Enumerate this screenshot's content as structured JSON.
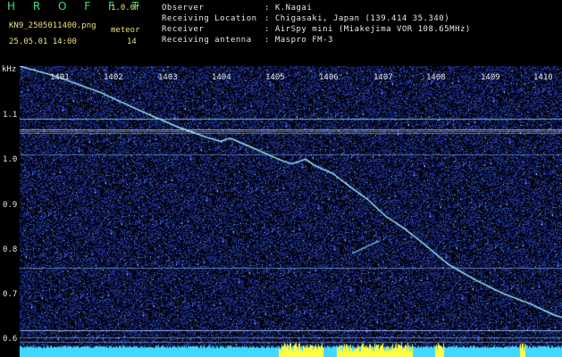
{
  "header": {
    "logo": "H R O F F T",
    "version": "1.0.0f",
    "filename": "KN9_2505011400.png",
    "datetime": "25.05.01 14:00",
    "meteor_label": "meteor",
    "meteor_count": "14"
  },
  "info": [
    {
      "label": "Observer",
      "value": ": K.Nagai"
    },
    {
      "label": "Receiving Location",
      "value": ": Chigasaki, Japan (139.414 35.340)"
    },
    {
      "label": "Receiver",
      "value": ": AirSpy mini (Miakejima VOR 108.65MHz)"
    },
    {
      "label": "Receiving antenna",
      "value": ": Maspro FM-3"
    }
  ],
  "axes": {
    "y_unit": "kHz",
    "x_ticks": [
      "1401",
      "1402",
      "1403",
      "1404",
      "1405",
      "1406",
      "1407",
      "1408",
      "1409",
      "1410"
    ],
    "y_ticks": [
      "1.1",
      "1.0",
      "0.9",
      "0.8",
      "0.7",
      "0.6"
    ]
  },
  "colors": {
    "background": "#000000",
    "noise": "#1b2fa0",
    "trace": "#9ef0ff",
    "band": "#7fd9ff",
    "bottom_strip": "#3fd8ff",
    "meteor_strip": "#ffff40",
    "logo": "#3ee07a"
  }
}
